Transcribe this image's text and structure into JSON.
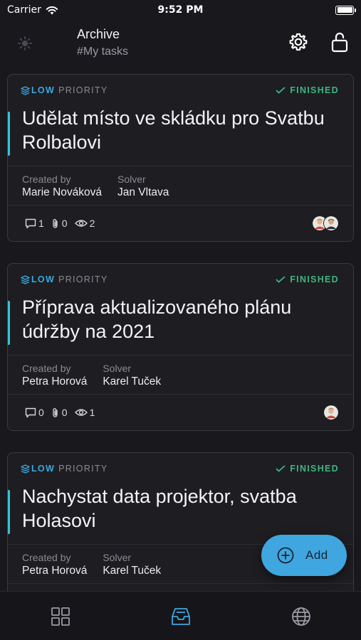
{
  "status_bar": {
    "carrier": "Carrier",
    "time": "9:52 PM"
  },
  "header": {
    "title": "Archive",
    "subtitle": "#My tasks"
  },
  "tasks": [
    {
      "priority_level": "LOW",
      "priority_word": "PRIORITY",
      "status": "FINISHED",
      "title": "Udělat místo ve skládku pro Svatbu Rolbalovi",
      "created_by_label": "Created by",
      "created_by": "Marie Nováková",
      "solver_label": "Solver",
      "solver": "Jan Vltava",
      "comments": "1",
      "attachments": "0",
      "views": "2"
    },
    {
      "priority_level": "LOW",
      "priority_word": "PRIORITY",
      "status": "FINISHED",
      "title": "Příprava aktualizovaného plánu údržby na 2021",
      "created_by_label": "Created by",
      "created_by": "Petra Horová",
      "solver_label": "Solver",
      "solver": "Karel Tuček",
      "comments": "0",
      "attachments": "0",
      "views": "1"
    },
    {
      "priority_level": "LOW",
      "priority_word": "PRIORITY",
      "status": "FINISHED",
      "title": "Nachystat data projektor, svatba Holasovi",
      "created_by_label": "Created by",
      "created_by": "Petra Horová",
      "solver_label": "Solver",
      "solver": "Karel Tuček"
    }
  ],
  "fab": {
    "label": "Add"
  },
  "tabs": [
    {
      "icon": "grid-icon",
      "active": false
    },
    {
      "icon": "inbox-icon",
      "active": true
    },
    {
      "icon": "globe-icon",
      "active": false
    }
  ],
  "colors": {
    "background": "#19191d",
    "card": "#1e1e22",
    "accent": "#3fa6e0",
    "priority_low": "#3aa8e0",
    "finished": "#3fb580",
    "title_accent": "#35c3d8"
  }
}
